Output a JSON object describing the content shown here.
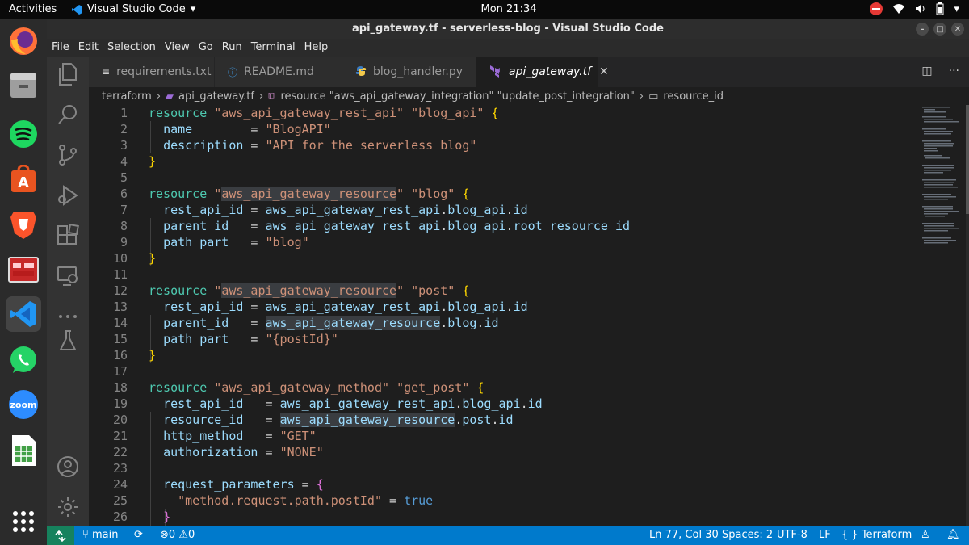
{
  "topbar": {
    "activities": "Activities",
    "app_name": "Visual Studio Code",
    "clock": "Mon 21:34"
  },
  "window": {
    "title": "api_gateway.tf - serverless-blog - Visual Studio Code"
  },
  "menu": [
    "File",
    "Edit",
    "Selection",
    "View",
    "Go",
    "Run",
    "Terminal",
    "Help"
  ],
  "tabs": [
    {
      "icon": "≡",
      "label": "requirements.txt"
    },
    {
      "icon": "ⓘ",
      "label": "README.md"
    },
    {
      "icon": "python-icon",
      "label": "blog_handler.py"
    },
    {
      "icon": "terraform-icon",
      "label": "api_gateway.tf",
      "close": "✕"
    }
  ],
  "breadcrumb": {
    "folder": "terraform",
    "file": "api_gateway.tf",
    "resource": "resource \"aws_api_gateway_integration\" \"update_post_integration\"",
    "field": "resource_id"
  },
  "code": {
    "line_numbers": [
      "1",
      "2",
      "3",
      "4",
      "5",
      "6",
      "7",
      "8",
      "9",
      "10",
      "11",
      "12",
      "13",
      "14",
      "15",
      "16",
      "17",
      "18",
      "19",
      "20",
      "21",
      "22",
      "23",
      "24",
      "25",
      "26"
    ]
  },
  "statusbar": {
    "branch": "main",
    "errors": "0",
    "warnings": "0",
    "position": "Ln 77, Col 30",
    "spaces": "Spaces: 2",
    "encoding": "UTF-8",
    "eol": "LF",
    "language": "Terraform"
  },
  "colors": {
    "status_bar": "#007acc",
    "editor_bg": "#1e1e1e",
    "keyword": "#4ec9b0",
    "string": "#ce9178"
  }
}
